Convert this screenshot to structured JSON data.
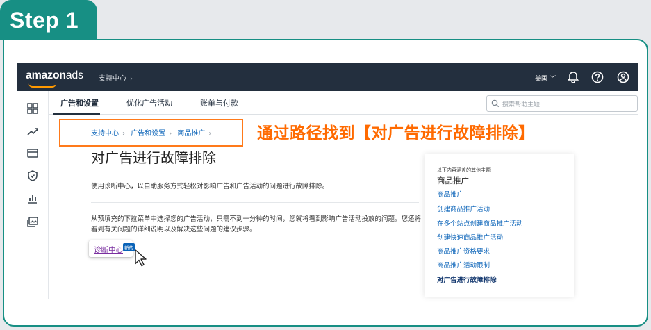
{
  "step_label": "Step 1",
  "topbar": {
    "logo_main": "amazon",
    "logo_suffix": "ads",
    "breadcrumb": "支持中心",
    "country": "美国"
  },
  "tabs": [
    {
      "label": "广告和设置",
      "active": true
    },
    {
      "label": "优化广告活动",
      "active": false
    },
    {
      "label": "账单与付款",
      "active": false
    }
  ],
  "search": {
    "placeholder": "搜索帮助主题"
  },
  "breadcrumb": [
    "支持中心",
    "广告和设置",
    "商品推广"
  ],
  "annotation": "通过路径找到【对广告进行故障排除】",
  "page": {
    "title": "对广告进行故障排除",
    "intro": "使用诊断中心，以自助服务方式轻松对影响广告和广告活动的问题进行故障排除。",
    "description": "从预填充的下拉菜单中选择您的广告活动，只需不到一分钟的时间，您就将看到影响广告活动投放的问题。您还将看到有关问题的详细说明以及解决这些问题的建议步骤。",
    "button_label": "诊断中心",
    "badge": "新的"
  },
  "related": {
    "small_label": "以下内容涵盖的其他主题",
    "heading": "商品推广",
    "links": [
      "商品推广",
      "创建商品推广活动",
      "在多个站点创建商品推广活动",
      "创建快速商品推广活动",
      "商品推广资格要求",
      "商品推广活动限制",
      "对广告进行故障排除"
    ]
  },
  "icons": {
    "top": [
      "chevron-down-icon",
      "bell-icon",
      "help-icon",
      "user-icon"
    ],
    "sidebar": [
      "dashboard-icon",
      "trend-icon",
      "wallet-icon",
      "shield-icon",
      "bar-chart-icon",
      "gallery-icon"
    ]
  },
  "colors": {
    "step_tab": "#178f84",
    "topbar": "#232f3e",
    "accent_orange": "#ff7a1a",
    "link": "#0a63b8"
  }
}
